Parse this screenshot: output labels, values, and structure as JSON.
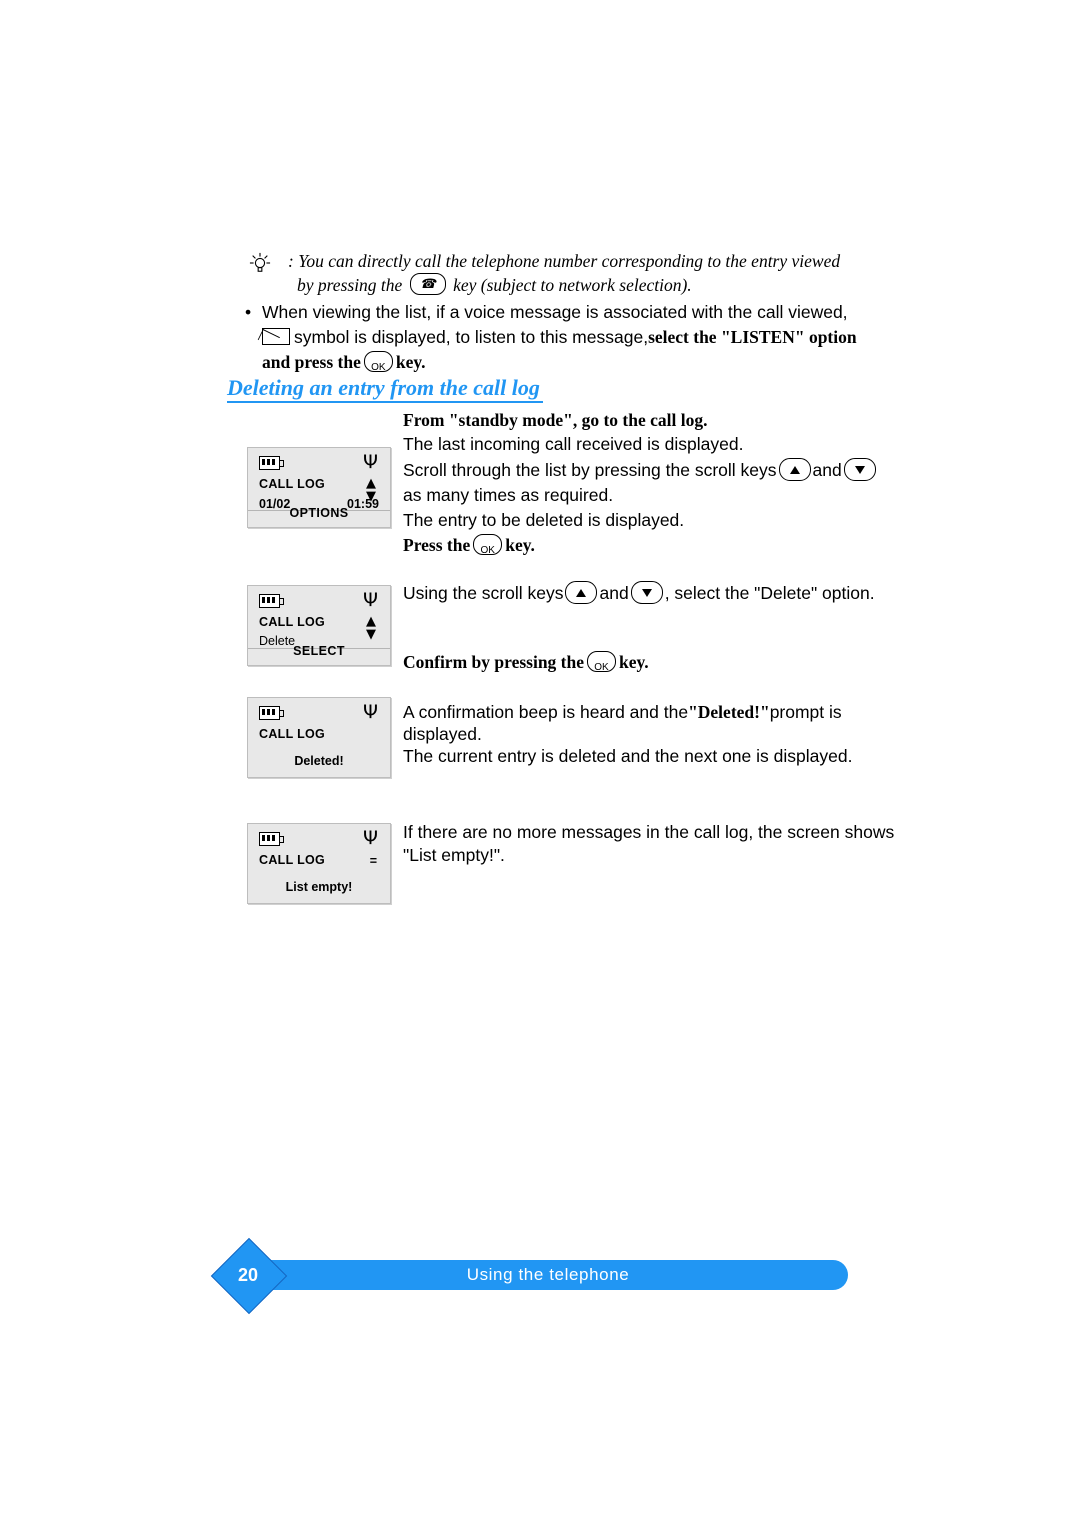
{
  "intro": {
    "tip_icon": "lightbulb-icon",
    "line1": ": You can directly call the telephone number corresponding to the entry viewed",
    "line2_before": "by pressing the",
    "phone_key_icon": "phone-handset-icon",
    "line2_after": "key (subject to network selection)."
  },
  "bullets": [
    {
      "marker": "•",
      "text": "When viewing the list, if a voice message is associated with the call viewed,"
    }
  ],
  "bullet_line2": {
    "envelope_icon": "envelope-icon",
    "text_before": "symbol is displayed, to listen to this message,",
    "bold_text": "select the \"LISTEN\" option"
  },
  "bullet_line3": {
    "bold_before": "and press the",
    "ok_key": "OK",
    "bold_after": "key."
  },
  "heading": "Deleting an entry from the call log",
  "steps": {
    "s1_bold": "From \"standby mode\", go to the call log.",
    "s2": "The last incoming call received is displayed.",
    "s3_before": "Scroll through the list by pressing the scroll keys",
    "s3_mid": "and",
    "s3_after": "as many times as required.",
    "s4": "The entry to be deleted is displayed.",
    "s5_before": "Press the",
    "s5_ok": "OK",
    "s5_after": "key.",
    "s6_before": "Using the scroll keys",
    "s6_mid": "and",
    "s6_after": ", select the \"Delete\" option.",
    "s7_before": "Confirm by pressing the",
    "s7_ok": "OK",
    "s7_after": "key.",
    "s8_before": "A confirmation beep is heard and the",
    "s8_bold": "\"Deleted!\"",
    "s8_after": "prompt is",
    "s8_line2": "displayed.",
    "s9": "The current entry is deleted and the next one is displayed.",
    "s10_line1": "If there are no more messages in the call log, the screen shows",
    "s10_line2": "\"List empty!\"."
  },
  "screens": [
    {
      "name": "call-log-options",
      "battery_icon": "battery-icon",
      "signal_icon": "antenna-icon",
      "title": "CALL LOG",
      "updown_icon": "up-down-arrows",
      "left_value": "01/02",
      "right_value": "01:59",
      "softkey": "OPTIONS"
    },
    {
      "name": "call-log-delete",
      "battery_icon": "battery-icon",
      "signal_icon": "antenna-icon",
      "title": "CALL LOG",
      "updown_icon": "up-down-arrows",
      "sub": "Delete",
      "softkey": "SELECT"
    },
    {
      "name": "call-log-deleted",
      "battery_icon": "battery-icon",
      "signal_icon": "antenna-icon",
      "title": "CALL LOG",
      "center": "Deleted!"
    },
    {
      "name": "call-log-empty",
      "battery_icon": "battery-icon",
      "signal_icon": "antenna-icon",
      "title": "CALL LOG",
      "updown_icon": "=",
      "center": "List empty!"
    }
  ],
  "footer": {
    "page_number": "20",
    "section_title": "Using the telephone",
    "accent_color": "#2196f3"
  }
}
